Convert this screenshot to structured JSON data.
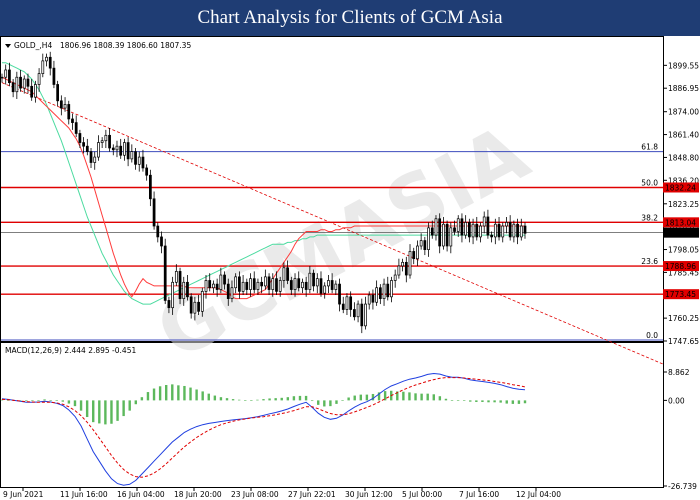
{
  "banner": {
    "title": "Chart Analysis for Clients of GCM Asia"
  },
  "header": {
    "symbol_label": "GOLD_,H4",
    "ohlc": "1806.96 1808.39 1806.60 1807.35"
  },
  "macd": {
    "label": "MACD(12,26,9) 2.444 2.895 -0.451",
    "y_labels": [
      "8.862",
      "0.00",
      "-26.739"
    ]
  },
  "watermark": "GCMASIA",
  "colors": {
    "banner": "#1f3d74",
    "fib": "#3d4bbd",
    "level": "#e00000",
    "ma_fast": "#ff3b3b",
    "ma_slow": "#4cdba0",
    "macd_hist": "#5cb85c",
    "macd_line": "#1f3fe0",
    "signal_line": "#e00000",
    "candle": "#000000"
  },
  "chart_data": [
    {
      "type": "candlestick",
      "symbol": "GOLD_",
      "timeframe": "H4",
      "ylim": [
        1747.65,
        1908.0
      ],
      "y_ticks": [
        "1899.55",
        "1886.95",
        "1874.00",
        "1861.40",
        "1848.80",
        "1836.20",
        "1823.25",
        "1810.65",
        "1798.05",
        "1785.45",
        "1772.50",
        "1760.25",
        "1747.65"
      ],
      "x_labels": [
        "9 Jun 2021",
        "11 Jun 16:00",
        "16 Jun 04:00",
        "18 Jun 20:00",
        "23 Jun 08:00",
        "27 Jun 22:01",
        "30 Jun 12:00",
        "5 Jul 00:00",
        "7 Jul 16:00",
        "12 Jul 04:00"
      ],
      "current_price": "1807.35",
      "fibonacci": [
        {
          "label": "61.8",
          "price": 1852.0
        },
        {
          "label": "50.0",
          "price": 1832.24
        },
        {
          "label": "38.2",
          "price": 1813.04
        },
        {
          "label": "23.6",
          "price": 1788.96
        },
        {
          "label": "0.0",
          "price": 1748.2
        }
      ],
      "levels": [
        {
          "label": "1832.24",
          "price": 1832.24
        },
        {
          "label": "1813.04",
          "price": 1813.04
        },
        {
          "label": "1788.96",
          "price": 1788.96
        },
        {
          "label": "1773.45",
          "price": 1773.45
        }
      ],
      "trendline": {
        "from": [
          0,
          1890.0
        ],
        "to": [
          154,
          1756.0
        ]
      },
      "close": [
        1893,
        1897,
        1890,
        1885,
        1893,
        1887,
        1892,
        1888,
        1882,
        1889,
        1895,
        1902,
        1904,
        1898,
        1889,
        1880,
        1876,
        1878,
        1870,
        1868,
        1862,
        1857,
        1855,
        1852,
        1846,
        1849,
        1857,
        1858,
        1861,
        1854,
        1853,
        1855,
        1850,
        1857,
        1848,
        1852,
        1845,
        1849,
        1843,
        1839,
        1826,
        1811,
        1805,
        1800,
        1770,
        1766,
        1780,
        1786,
        1771,
        1780,
        1772,
        1763,
        1769,
        1764,
        1775,
        1781,
        1777,
        1779,
        1776,
        1784,
        1779,
        1771,
        1777,
        1783,
        1775,
        1780,
        1776,
        1782,
        1776,
        1780,
        1778,
        1783,
        1776,
        1782,
        1775,
        1781,
        1788,
        1781,
        1776,
        1782,
        1777,
        1780,
        1776,
        1785,
        1778,
        1782,
        1774,
        1778,
        1781,
        1776,
        1779,
        1768,
        1765,
        1772,
        1765,
        1761,
        1768,
        1756,
        1768,
        1773,
        1769,
        1777,
        1771,
        1779,
        1772,
        1781,
        1784,
        1789,
        1791,
        1784,
        1797,
        1793,
        1800,
        1803,
        1798,
        1810,
        1806,
        1815,
        1800,
        1812,
        1800,
        1810,
        1808,
        1815,
        1806,
        1813,
        1805,
        1812,
        1805,
        1811,
        1816,
        1806,
        1805,
        1812,
        1805,
        1811,
        1813,
        1805,
        1812,
        1805,
        1811,
        1807
      ],
      "ma_fast": [
        1893,
        1892,
        1891,
        1890,
        1889,
        1888,
        1887,
        1886,
        1885,
        1883,
        1881,
        1879,
        1877,
        1875,
        1873,
        1871,
        1869,
        1867,
        1865,
        1862,
        1859,
        1855,
        1850,
        1844,
        1838,
        1831,
        1824,
        1817,
        1810,
        1803,
        1796,
        1790,
        1784,
        1779,
        1775,
        1772,
        1775,
        1779,
        1782,
        1780,
        1779,
        1778,
        1778,
        1778,
        1778,
        1778,
        1778,
        1778,
        1778,
        1778,
        1777,
        1777,
        1777,
        1777,
        1777,
        1777,
        1777,
        1777,
        1777,
        1776,
        1775,
        1774,
        1772,
        1771,
        1771,
        1771,
        1771,
        1772,
        1773,
        1774,
        1775,
        1776,
        1779,
        1782,
        1785,
        1788,
        1791,
        1794,
        1797,
        1801,
        1804,
        1806,
        1808,
        1808,
        1808,
        1808,
        1809,
        1809,
        1808,
        1808,
        1809,
        1809,
        1810,
        1810,
        1810,
        1811,
        1811,
        1811,
        1811,
        1811,
        1811,
        1811,
        1811,
        1811,
        1811,
        1811,
        1811,
        1811,
        1811,
        1811,
        1811,
        1811,
        1811,
        1811,
        1811,
        1811,
        1811,
        1811,
        1811,
        1811,
        1811,
        1811,
        1811,
        1811,
        1811,
        1811,
        1811,
        1811,
        1811,
        1811,
        1811,
        1811,
        1811,
        1811,
        1811,
        1811,
        1811,
        1811,
        1811,
        1811,
        1811,
        1811
      ],
      "ma_slow": [
        1901,
        1901,
        1900,
        1899,
        1898,
        1897,
        1896,
        1894,
        1892,
        1889,
        1886,
        1882,
        1878,
        1873,
        1868,
        1863,
        1858,
        1852,
        1846,
        1840,
        1834,
        1828,
        1822,
        1816,
        1811,
        1806,
        1801,
        1796,
        1792,
        1788,
        1784,
        1781,
        1778,
        1775,
        1773,
        1771,
        1770,
        1769,
        1768,
        1768,
        1768,
        1769,
        1770,
        1771,
        1772,
        1773,
        1774,
        1775,
        1776,
        1777,
        1778,
        1779,
        1780,
        1781,
        1782,
        1783,
        1784,
        1785,
        1786,
        1787,
        1788,
        1789,
        1790,
        1791,
        1792,
        1793,
        1794,
        1795,
        1796,
        1797,
        1798,
        1799,
        1800,
        1801,
        1801,
        1801,
        1801,
        1802,
        1802,
        1803,
        1803,
        1804,
        1804,
        1805,
        1805,
        1806,
        1806,
        1806,
        1806,
        1806,
        1806,
        1806,
        1806,
        1806,
        1806,
        1806,
        1806,
        1806,
        1806,
        1806,
        1806,
        1806,
        1806,
        1806,
        1806,
        1806,
        1806,
        1806,
        1806,
        1806,
        1806,
        1806,
        1806,
        1806,
        1806,
        1806,
        1806,
        1806,
        1806,
        1806,
        1806,
        1806,
        1806,
        1806,
        1806,
        1806,
        1806,
        1806,
        1806,
        1806,
        1806,
        1806,
        1806,
        1806,
        1806,
        1806,
        1806,
        1806,
        1806,
        1806,
        1806,
        1806
      ]
    },
    {
      "type": "line",
      "name": "MACD(12,26,9)",
      "ylim": [
        -26.739,
        8.862
      ],
      "macd": [
        0.5,
        0.3,
        0,
        -0.3,
        -0.6,
        -0.6,
        -0.5,
        -0.3,
        -0.5,
        -0.9,
        -1.6,
        -3,
        -5,
        -8,
        -12,
        -16,
        -19,
        -22,
        -24.5,
        -26,
        -26.5,
        -26.2,
        -25,
        -23,
        -21,
        -19,
        -17,
        -15,
        -13,
        -11.5,
        -10,
        -9,
        -8.2,
        -7.6,
        -7.2,
        -6.9,
        -6.6,
        -6.3,
        -6.1,
        -5.9,
        -5.7,
        -5.4,
        -5.1,
        -4.7,
        -4.2,
        -3.8,
        -3.3,
        -2.7,
        -1.9,
        -1.2,
        -0.6,
        -2.2,
        -4,
        -5.3,
        -5.9,
        -5.6,
        -4.6,
        -3.3,
        -2.1,
        -1.1,
        -0.4,
        0.6,
        2,
        3.4,
        4.5,
        5.2,
        6,
        6.6,
        7,
        7.5,
        8.1,
        8.4,
        8.2,
        7.6,
        7.2,
        7.2,
        6.9,
        6.4,
        6.1,
        5.9,
        5.6,
        5.3,
        4.9,
        4.3,
        3.8,
        3.5,
        3.3
      ],
      "signal": [
        0.3,
        0.2,
        0,
        -0.2,
        -0.4,
        -0.5,
        -0.6,
        -0.6,
        -0.6,
        -0.8,
        -1.2,
        -2,
        -3.2,
        -4.8,
        -6.8,
        -9.2,
        -11.8,
        -14.5,
        -17.2,
        -19.6,
        -21.6,
        -23,
        -23.8,
        -24,
        -23.6,
        -22.7,
        -21.4,
        -19.8,
        -18,
        -16.2,
        -14.5,
        -13,
        -11.6,
        -10.4,
        -9.3,
        -8.4,
        -7.6,
        -7,
        -6.5,
        -6.1,
        -5.8,
        -5.5,
        -5.3,
        -5.1,
        -4.8,
        -4.5,
        -4.1,
        -3.7,
        -3.2,
        -2.6,
        -2,
        -2,
        -2.6,
        -3.4,
        -4.1,
        -4.5,
        -4.5,
        -4.2,
        -3.6,
        -2.9,
        -2.2,
        -1.4,
        -0.5,
        0.5,
        1.5,
        2.4,
        3.3,
        4.1,
        4.8,
        5.4,
        6,
        6.5,
        6.9,
        7.1,
        7.1,
        7.1,
        7,
        6.8,
        6.6,
        6.4,
        6.2,
        5.9,
        5.6,
        5.3,
        4.9,
        4.6,
        4.2
      ]
    }
  ]
}
